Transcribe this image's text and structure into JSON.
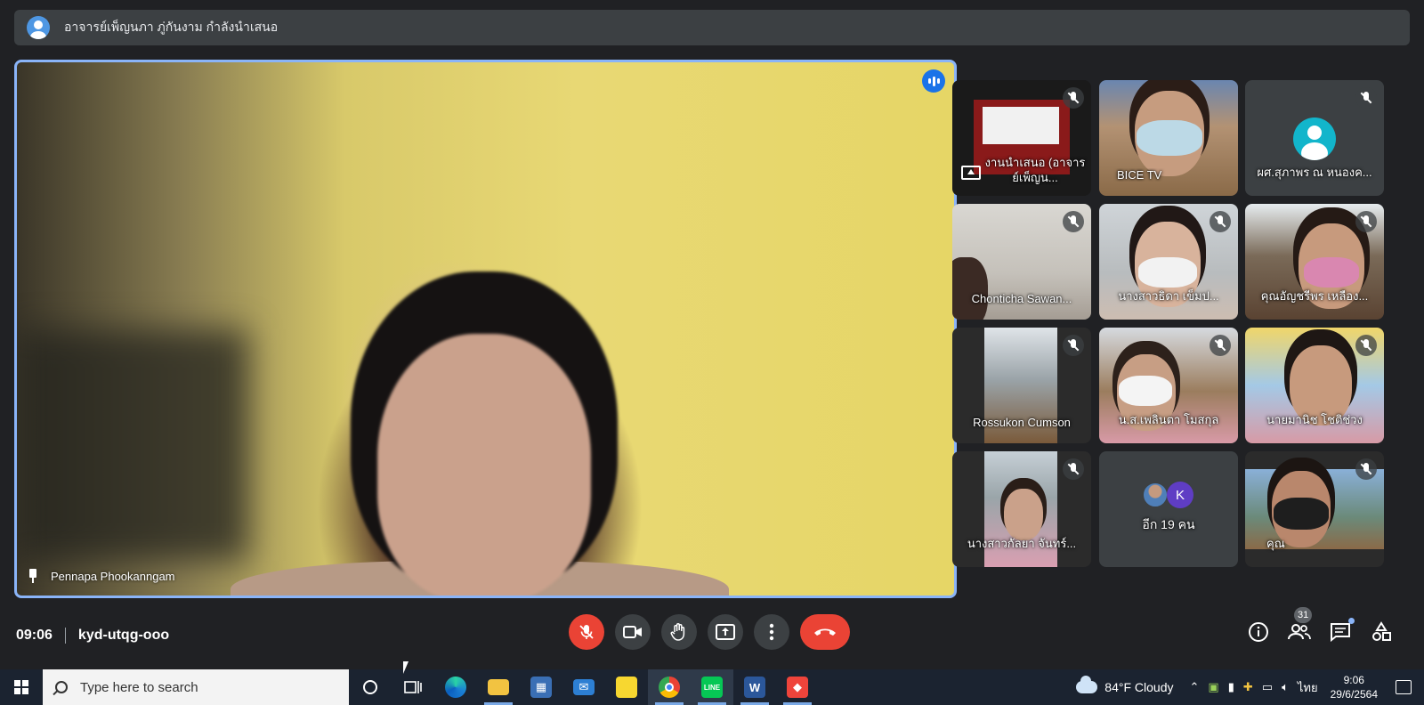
{
  "banner": {
    "text": "อาจารย์เพ็ญนภา ภู่กันงาม กำลังนำเสนอ"
  },
  "main_video": {
    "name": "Pennapa Phookanngam"
  },
  "tiles": [
    {
      "label": "งานนำเสนอ (อาจารย์เพ็ญน..."
    },
    {
      "label": "BICE TV"
    },
    {
      "label": "ผศ.สุภาพร ณ หนองค..."
    },
    {
      "label": "Chonticha Sawan..."
    },
    {
      "label": "นางสาวธิดา เข็มป..."
    },
    {
      "label": "คุณอัญชรีพร เหลือง..."
    },
    {
      "label": "Rossukon Cumson"
    },
    {
      "label": "น.ส.เพลินตา โมสกุล"
    },
    {
      "label": "นายมานิช โชติช่วง"
    },
    {
      "label": "นางสาวกัลยา จันทร์..."
    },
    {
      "label": "อีก 19 คน",
      "avatar_letter": "K"
    },
    {
      "label": "คุณ"
    }
  ],
  "meeting": {
    "time": "09:06",
    "code": "kyd-utqg-ooo"
  },
  "controls": {
    "mic": "mic-off",
    "camera": "camera",
    "hand": "raise-hand",
    "present": "present-now",
    "more": "more-options",
    "leave": "leave-call"
  },
  "right_controls": {
    "participants_count": "31"
  },
  "taskbar": {
    "search_placeholder": "Type here to search",
    "weather": "84°F  Cloudy",
    "language": "ไทย",
    "time": "9:06",
    "date": "29/6/2564"
  },
  "colors": {
    "accent": "#8ab4f8",
    "danger": "#ea4335",
    "surface": "#3c4043",
    "background": "#202124"
  }
}
